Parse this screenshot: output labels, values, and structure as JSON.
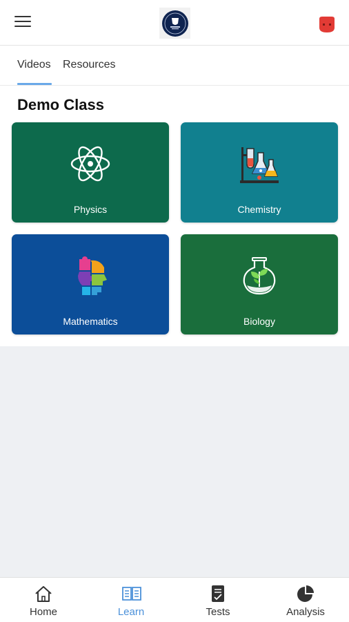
{
  "colors": {
    "physics_card": "#0d6a4c",
    "chemistry_card": "#11808f",
    "mathematics_card": "#0c4e99",
    "biology_card": "#1a6e3c",
    "active_tab_underline": "#6aa9e9",
    "active_nav": "#4a90d9",
    "profile_icon": "#e23b35"
  },
  "header": {
    "menu_icon": "hamburger-menu-icon",
    "logo_icon": "academy-logo-icon",
    "profile_icon": "profile-icon"
  },
  "tabs": [
    {
      "label": "Videos",
      "active": true
    },
    {
      "label": "Resources",
      "active": false
    }
  ],
  "section": {
    "title": "Demo Class"
  },
  "subjects": [
    {
      "label": "Physics",
      "icon": "atom-icon"
    },
    {
      "label": "Chemistry",
      "icon": "lab-flasks-icon"
    },
    {
      "label": "Mathematics",
      "icon": "puzzle-head-icon"
    },
    {
      "label": "Biology",
      "icon": "plant-flask-icon"
    }
  ],
  "bottom_nav": [
    {
      "label": "Home",
      "icon": "home-icon",
      "active": false
    },
    {
      "label": "Learn",
      "icon": "book-icon",
      "active": true
    },
    {
      "label": "Tests",
      "icon": "test-sheet-icon",
      "active": false
    },
    {
      "label": "Analysis",
      "icon": "pie-chart-icon",
      "active": false
    }
  ]
}
